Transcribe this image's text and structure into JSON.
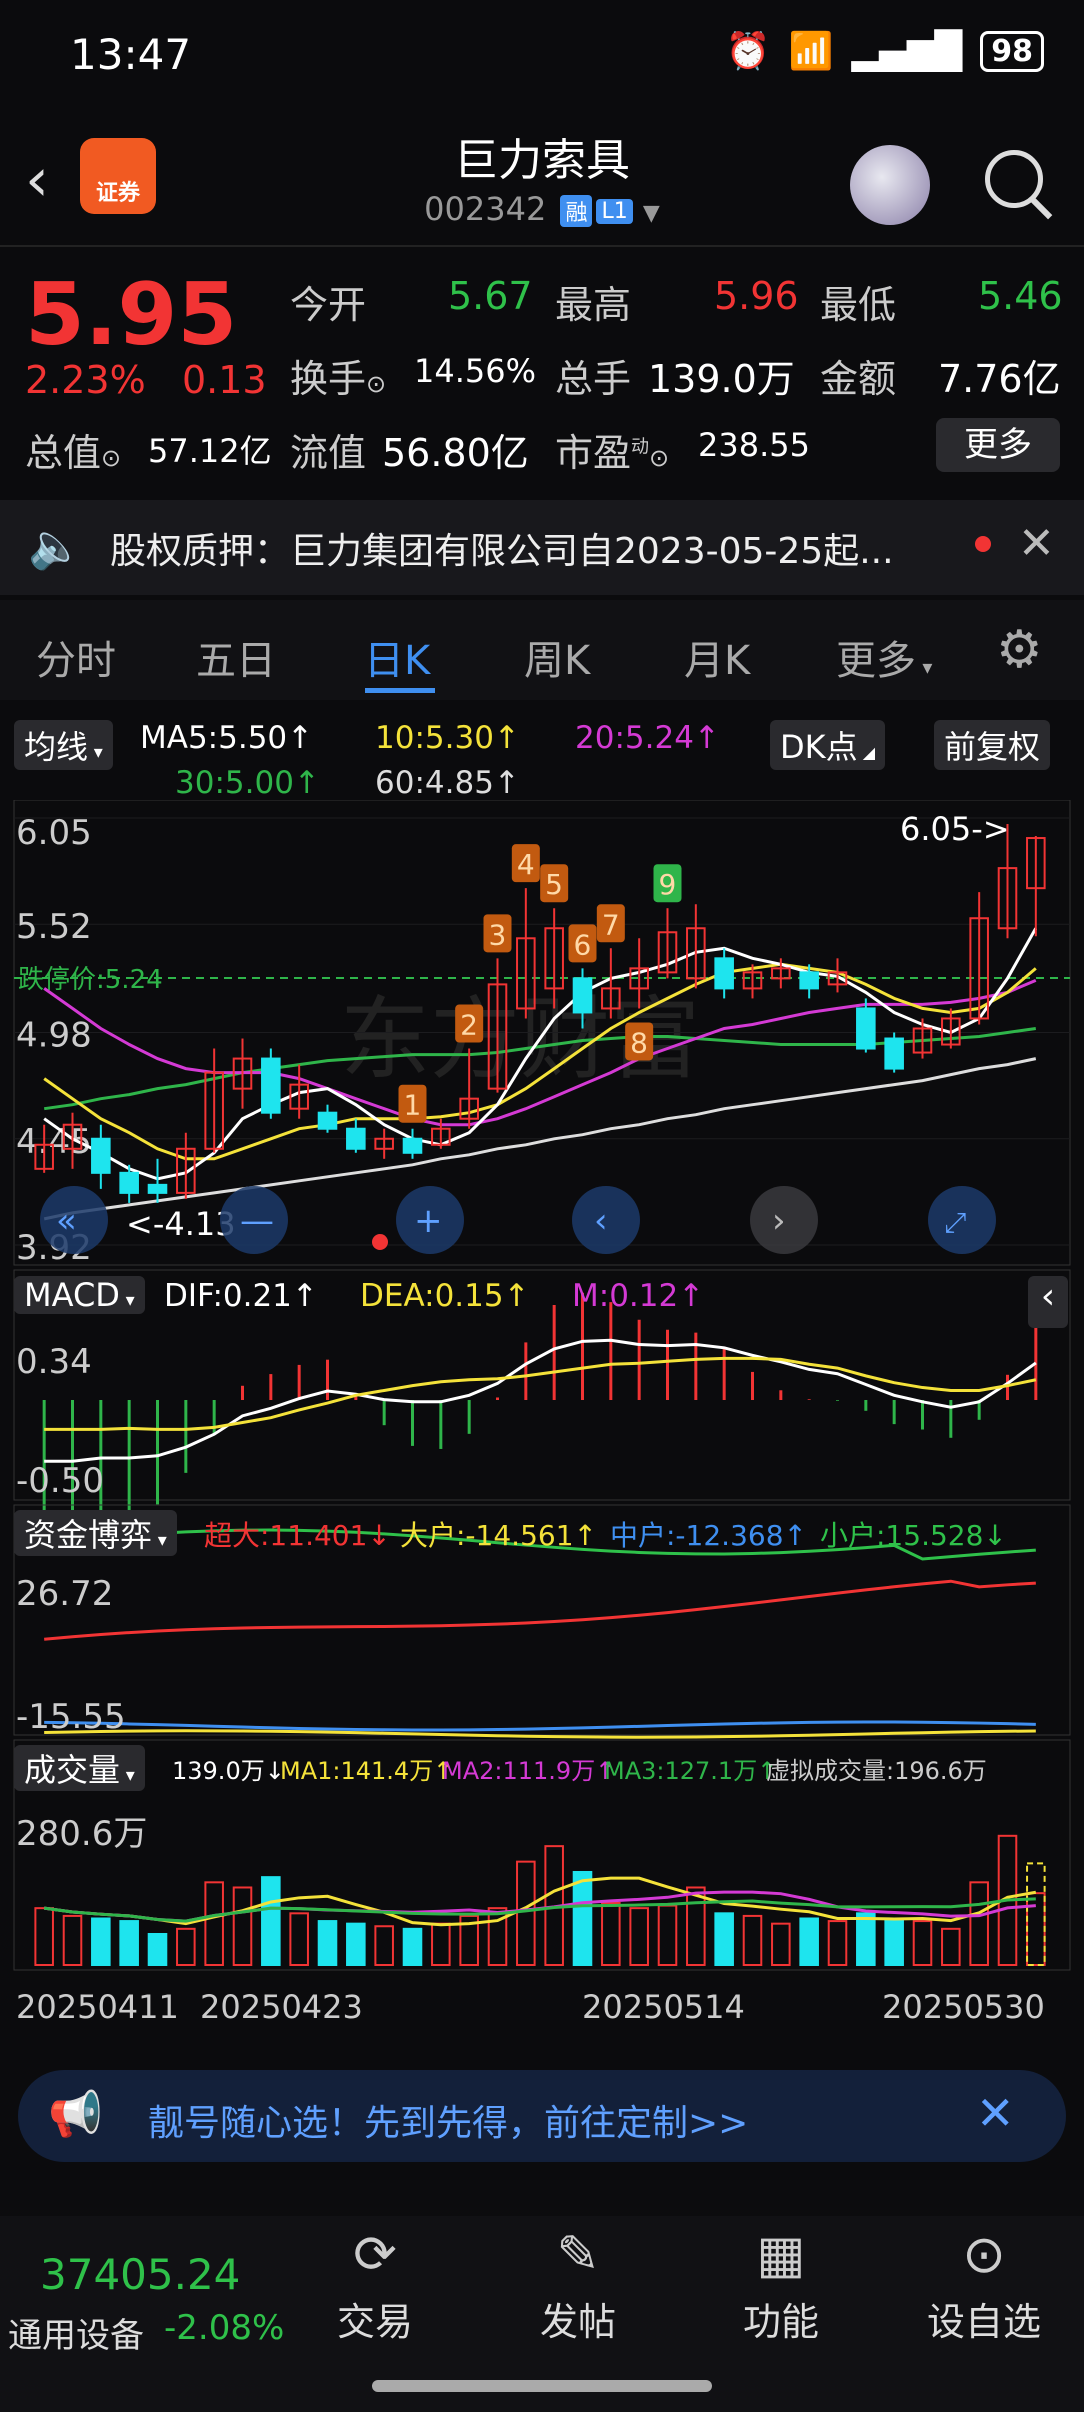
{
  "status": {
    "time": "13:47",
    "battery": "98"
  },
  "header": {
    "title": "巨力索具",
    "code": "002342",
    "tag_rong": "融",
    "tag_level": "L1",
    "brand_text": "证券"
  },
  "quote": {
    "price": "5.95",
    "change_pct": "2.23%",
    "change_amt": "0.13",
    "open_label": "今开",
    "open": "5.67",
    "high_label": "最高",
    "high": "5.96",
    "low_label": "最低",
    "low": "5.46",
    "turnover_label": "换手",
    "turnover": "14.56%",
    "volume_label": "总手",
    "volume": "139.0万",
    "amount_label": "金额",
    "amount": "7.76亿",
    "total_mv_label": "总值",
    "total_mv": "57.12亿",
    "float_mv_label": "流值",
    "float_mv": "56.80亿",
    "pe_label": "市盈",
    "pe_sup": "动",
    "pe": "238.55",
    "more_label": "更多"
  },
  "notice": {
    "text": "股权质押：巨力集团有限公司自2023-05-25起..."
  },
  "tabs": [
    "分时",
    "五日",
    "日K",
    "周K",
    "月K",
    "更多"
  ],
  "ma_bar": {
    "toggle": "均线",
    "ma5": "MA5:5.50↑",
    "ma10": "10:5.30↑",
    "ma20": "20:5.24↑",
    "ma30": "30:5.00↑",
    "ma60": "60:4.85↑",
    "dk": "DK点",
    "fuquan": "前复权"
  },
  "kline": {
    "y_labels": [
      "6.05",
      "5.52",
      "4.98",
      "4.45",
      "3.92"
    ],
    "limit_label": "跌停价:5.24",
    "high_annot": "6.05->",
    "low_annot": "<-4.13",
    "seq_numbers": [
      "1",
      "2",
      "3",
      "4",
      "5",
      "6",
      "7",
      "8",
      "9"
    ],
    "watermark": "东方财富"
  },
  "macd": {
    "label": "MACD",
    "dif": "DIF:0.21↑",
    "dea": "DEA:0.15↑",
    "m": "M:0.12↑",
    "y_top": "0.34",
    "y_bottom": "-0.50"
  },
  "fund": {
    "label": "资金博弈",
    "super": "超大:11.401↓",
    "big": "大户:-14.561↑",
    "mid": "中户:-12.368↑",
    "small": "小户:15.528↓",
    "y_top": "26.72",
    "y_bottom": "-15.55"
  },
  "vol": {
    "label": "成交量",
    "v": "139.0万↓",
    "ma1": "MA1:141.4万↑",
    "ma2": "MA2:111.9万↑",
    "ma3": "MA3:127.1万↑",
    "virtual": "虚拟成交量:196.6万",
    "y_top": "280.6万"
  },
  "dates": [
    "20250411",
    "20250423",
    "20250514",
    "20250530"
  ],
  "promo": {
    "text": "靓号随心选！先到先得，前往定制>>"
  },
  "bottom": {
    "index_value": "37405.24",
    "index_name": "通用设备",
    "index_change": "-2.08%",
    "nav": [
      "交易",
      "发帖",
      "功能",
      "设自选"
    ]
  },
  "colors": {
    "up": "#f23434",
    "down": "#1ee4ee",
    "ma5": "#ffffff",
    "ma10": "#f4e23a",
    "ma20": "#d43ad4",
    "ma30": "#2fb54a",
    "ma60": "#dddddd"
  },
  "chart_data": {
    "type": "candlestick",
    "ylim": [
      3.92,
      6.05
    ],
    "candles": [
      {
        "o": 4.3,
        "c": 4.42,
        "h": 4.52,
        "l": 4.28
      },
      {
        "o": 4.4,
        "c": 4.52,
        "h": 4.58,
        "l": 4.3
      },
      {
        "o": 4.45,
        "c": 4.28,
        "h": 4.52,
        "l": 4.2
      },
      {
        "o": 4.28,
        "c": 4.18,
        "h": 4.32,
        "l": 4.13
      },
      {
        "o": 4.22,
        "c": 4.18,
        "h": 4.35,
        "l": 4.13
      },
      {
        "o": 4.18,
        "c": 4.4,
        "h": 4.48,
        "l": 4.15
      },
      {
        "o": 4.4,
        "c": 4.78,
        "h": 4.9,
        "l": 4.38
      },
      {
        "o": 4.7,
        "c": 4.85,
        "h": 4.95,
        "l": 4.6
      },
      {
        "o": 4.85,
        "c": 4.58,
        "h": 4.9,
        "l": 4.55
      },
      {
        "o": 4.6,
        "c": 4.72,
        "h": 4.82,
        "l": 4.55
      },
      {
        "o": 4.58,
        "c": 4.5,
        "h": 4.62,
        "l": 4.48
      },
      {
        "o": 4.5,
        "c": 4.4,
        "h": 4.55,
        "l": 4.38
      },
      {
        "o": 4.4,
        "c": 4.45,
        "h": 4.5,
        "l": 4.35
      },
      {
        "o": 4.45,
        "c": 4.38,
        "h": 4.5,
        "l": 4.35
      },
      {
        "o": 4.42,
        "c": 4.5,
        "h": 4.55,
        "l": 4.4
      },
      {
        "o": 4.55,
        "c": 4.65,
        "h": 4.9,
        "l": 4.5
      },
      {
        "o": 4.7,
        "c": 5.22,
        "h": 5.35,
        "l": 4.68
      },
      {
        "o": 5.1,
        "c": 5.45,
        "h": 5.7,
        "l": 5.05
      },
      {
        "o": 5.2,
        "c": 5.5,
        "h": 5.6,
        "l": 5.1
      },
      {
        "o": 5.25,
        "c": 5.08,
        "h": 5.3,
        "l": 5.0
      },
      {
        "o": 5.1,
        "c": 5.2,
        "h": 5.4,
        "l": 5.05
      },
      {
        "o": 5.2,
        "c": 5.3,
        "h": 5.45,
        "l": 5.1
      },
      {
        "o": 5.28,
        "c": 5.48,
        "h": 5.6,
        "l": 5.25
      },
      {
        "o": 5.25,
        "c": 5.5,
        "h": 5.62,
        "l": 5.2
      },
      {
        "o": 5.35,
        "c": 5.2,
        "h": 5.4,
        "l": 5.15
      },
      {
        "o": 5.2,
        "c": 5.28,
        "h": 5.32,
        "l": 5.15
      },
      {
        "o": 5.25,
        "c": 5.3,
        "h": 5.35,
        "l": 5.2
      },
      {
        "o": 5.28,
        "c": 5.2,
        "h": 5.32,
        "l": 5.15
      },
      {
        "o": 5.22,
        "c": 5.28,
        "h": 5.35,
        "l": 5.18
      },
      {
        "o": 5.1,
        "c": 4.9,
        "h": 5.15,
        "l": 4.88
      },
      {
        "o": 4.95,
        "c": 4.8,
        "h": 4.98,
        "l": 4.78
      },
      {
        "o": 4.88,
        "c": 5.0,
        "h": 5.05,
        "l": 4.85
      },
      {
        "o": 4.92,
        "c": 5.05,
        "h": 5.1,
        "l": 4.9
      },
      {
        "o": 5.05,
        "c": 5.55,
        "h": 5.68,
        "l": 5.02
      },
      {
        "o": 5.5,
        "c": 5.8,
        "h": 6.02,
        "l": 5.45
      },
      {
        "o": 5.7,
        "c": 5.95,
        "h": 5.96,
        "l": 5.46
      }
    ],
    "ma5": [
      4.55,
      4.45,
      4.38,
      4.3,
      4.25,
      4.28,
      4.38,
      4.55,
      4.62,
      4.68,
      4.7,
      4.62,
      4.52,
      4.45,
      4.42,
      4.48,
      4.62,
      4.85,
      5.05,
      5.18,
      5.25,
      5.28,
      5.32,
      5.38,
      5.4,
      5.35,
      5.32,
      5.28,
      5.26,
      5.18,
      5.08,
      5.02,
      4.98,
      5.05,
      5.25,
      5.5
    ],
    "ma10": [
      4.75,
      4.65,
      4.55,
      4.48,
      4.4,
      4.35,
      4.35,
      4.4,
      4.45,
      4.5,
      4.52,
      4.55,
      4.55,
      4.55,
      4.56,
      4.58,
      4.62,
      4.7,
      4.8,
      4.9,
      5.0,
      5.08,
      5.15,
      5.22,
      5.28,
      5.3,
      5.32,
      5.3,
      5.28,
      5.22,
      5.15,
      5.1,
      5.08,
      5.1,
      5.18,
      5.3
    ],
    "ma20": [
      5.2,
      5.1,
      5.0,
      4.92,
      4.85,
      4.8,
      4.78,
      4.78,
      4.78,
      4.75,
      4.7,
      4.65,
      4.6,
      4.55,
      4.52,
      4.52,
      4.55,
      4.6,
      4.66,
      4.72,
      4.78,
      4.85,
      4.9,
      4.95,
      5.0,
      5.02,
      5.05,
      5.08,
      5.1,
      5.12,
      5.12,
      5.12,
      5.13,
      5.15,
      5.18,
      5.24
    ],
    "ma30": [
      4.6,
      4.62,
      4.65,
      4.67,
      4.7,
      4.72,
      4.75,
      4.78,
      4.8,
      4.82,
      4.84,
      4.85,
      4.86,
      4.87,
      4.87,
      4.87,
      4.88,
      4.9,
      4.92,
      4.94,
      4.95,
      4.96,
      4.96,
      4.95,
      4.94,
      4.93,
      4.92,
      4.92,
      4.92,
      4.92,
      4.93,
      4.94,
      4.95,
      4.96,
      4.98,
      5.0
    ],
    "ma60": [
      4.05,
      4.08,
      4.1,
      4.12,
      4.14,
      4.16,
      4.18,
      4.2,
      4.22,
      4.24,
      4.26,
      4.28,
      4.3,
      4.32,
      4.35,
      4.37,
      4.4,
      4.42,
      4.45,
      4.47,
      4.5,
      4.52,
      4.55,
      4.57,
      4.6,
      4.62,
      4.64,
      4.66,
      4.68,
      4.7,
      4.72,
      4.74,
      4.77,
      4.8,
      4.82,
      4.85
    ],
    "volumes": [
      110,
      95,
      90,
      85,
      60,
      70,
      160,
      150,
      170,
      100,
      85,
      80,
      75,
      70,
      80,
      95,
      110,
      200,
      230,
      180,
      120,
      110,
      115,
      150,
      100,
      95,
      80,
      90,
      85,
      100,
      90,
      85,
      70,
      160,
      250,
      139
    ],
    "volume_ylim": [
      0,
      280.6
    ]
  }
}
